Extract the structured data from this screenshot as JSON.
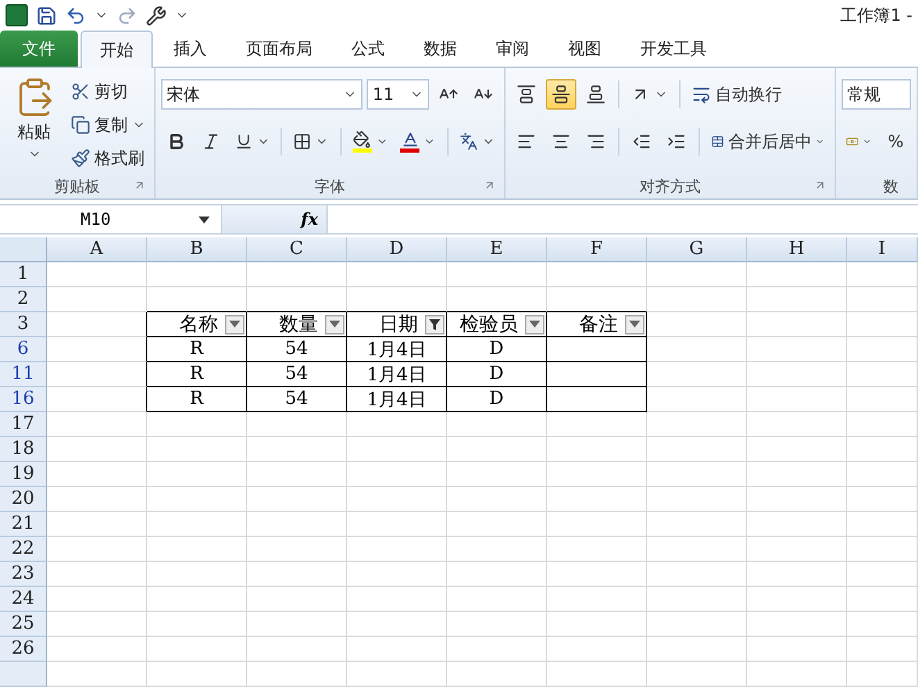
{
  "window": {
    "title": "工作簿1 -"
  },
  "tabs": [
    {
      "label": "文件",
      "kind": "file",
      "selected": false
    },
    {
      "label": "开始",
      "kind": "tab",
      "selected": true
    },
    {
      "label": "插入",
      "kind": "tab",
      "selected": false
    },
    {
      "label": "页面布局",
      "kind": "tab",
      "selected": false
    },
    {
      "label": "公式",
      "kind": "tab",
      "selected": false
    },
    {
      "label": "数据",
      "kind": "tab",
      "selected": false
    },
    {
      "label": "审阅",
      "kind": "tab",
      "selected": false
    },
    {
      "label": "视图",
      "kind": "tab",
      "selected": false
    },
    {
      "label": "开发工具",
      "kind": "tab",
      "selected": false
    }
  ],
  "ribbon": {
    "clipboard": {
      "label": "剪贴板",
      "paste": "粘贴",
      "actions": [
        "剪切",
        "复制",
        "格式刷"
      ]
    },
    "font": {
      "label": "字体",
      "font_name": "宋体",
      "font_size": "11"
    },
    "alignment": {
      "label": "对齐方式",
      "vertical": [
        {
          "selected": false
        },
        {
          "selected": true
        },
        {
          "selected": false
        }
      ],
      "wrap": "自动换行",
      "merge": "合并后居中"
    },
    "number": {
      "format": "常规",
      "percent": "%",
      "label": "数"
    }
  },
  "formula_bar": {
    "name_box": "M10",
    "function_label": "fx"
  },
  "sheet": {
    "columns": [
      "A",
      "B",
      "C",
      "D",
      "E",
      "F",
      "G",
      "H",
      "I"
    ],
    "table_header": [
      {
        "text": "名称",
        "filtered": false
      },
      {
        "text": "数量",
        "filtered": false
      },
      {
        "text": "日期",
        "filtered": true
      },
      {
        "text": "检验员",
        "filtered": false
      },
      {
        "text": "备注",
        "filtered": false
      }
    ],
    "rows": [
      {
        "label": "1",
        "filtered": false
      },
      {
        "label": "2",
        "filtered": false
      },
      {
        "label": "3",
        "filtered": false,
        "kind": "header"
      },
      {
        "label": "6",
        "filtered": true,
        "kind": "data",
        "cells": [
          "R",
          "54",
          "1月4日",
          "D"
        ]
      },
      {
        "label": "11",
        "filtered": true,
        "kind": "data",
        "cells": [
          "R",
          "54",
          "1月4日",
          "D"
        ]
      },
      {
        "label": "16",
        "filtered": true,
        "kind": "data",
        "cells": [
          "R",
          "54",
          "1月4日",
          "D"
        ]
      },
      {
        "label": "17",
        "filtered": false
      },
      {
        "label": "18",
        "filtered": false
      },
      {
        "label": "19",
        "filtered": false
      },
      {
        "label": "20",
        "filtered": false
      },
      {
        "label": "21",
        "filtered": false
      },
      {
        "label": "22",
        "filtered": false
      },
      {
        "label": "23",
        "filtered": false
      },
      {
        "label": "24",
        "filtered": false
      },
      {
        "label": "25",
        "filtered": false
      },
      {
        "label": "26",
        "filtered": false
      }
    ]
  }
}
